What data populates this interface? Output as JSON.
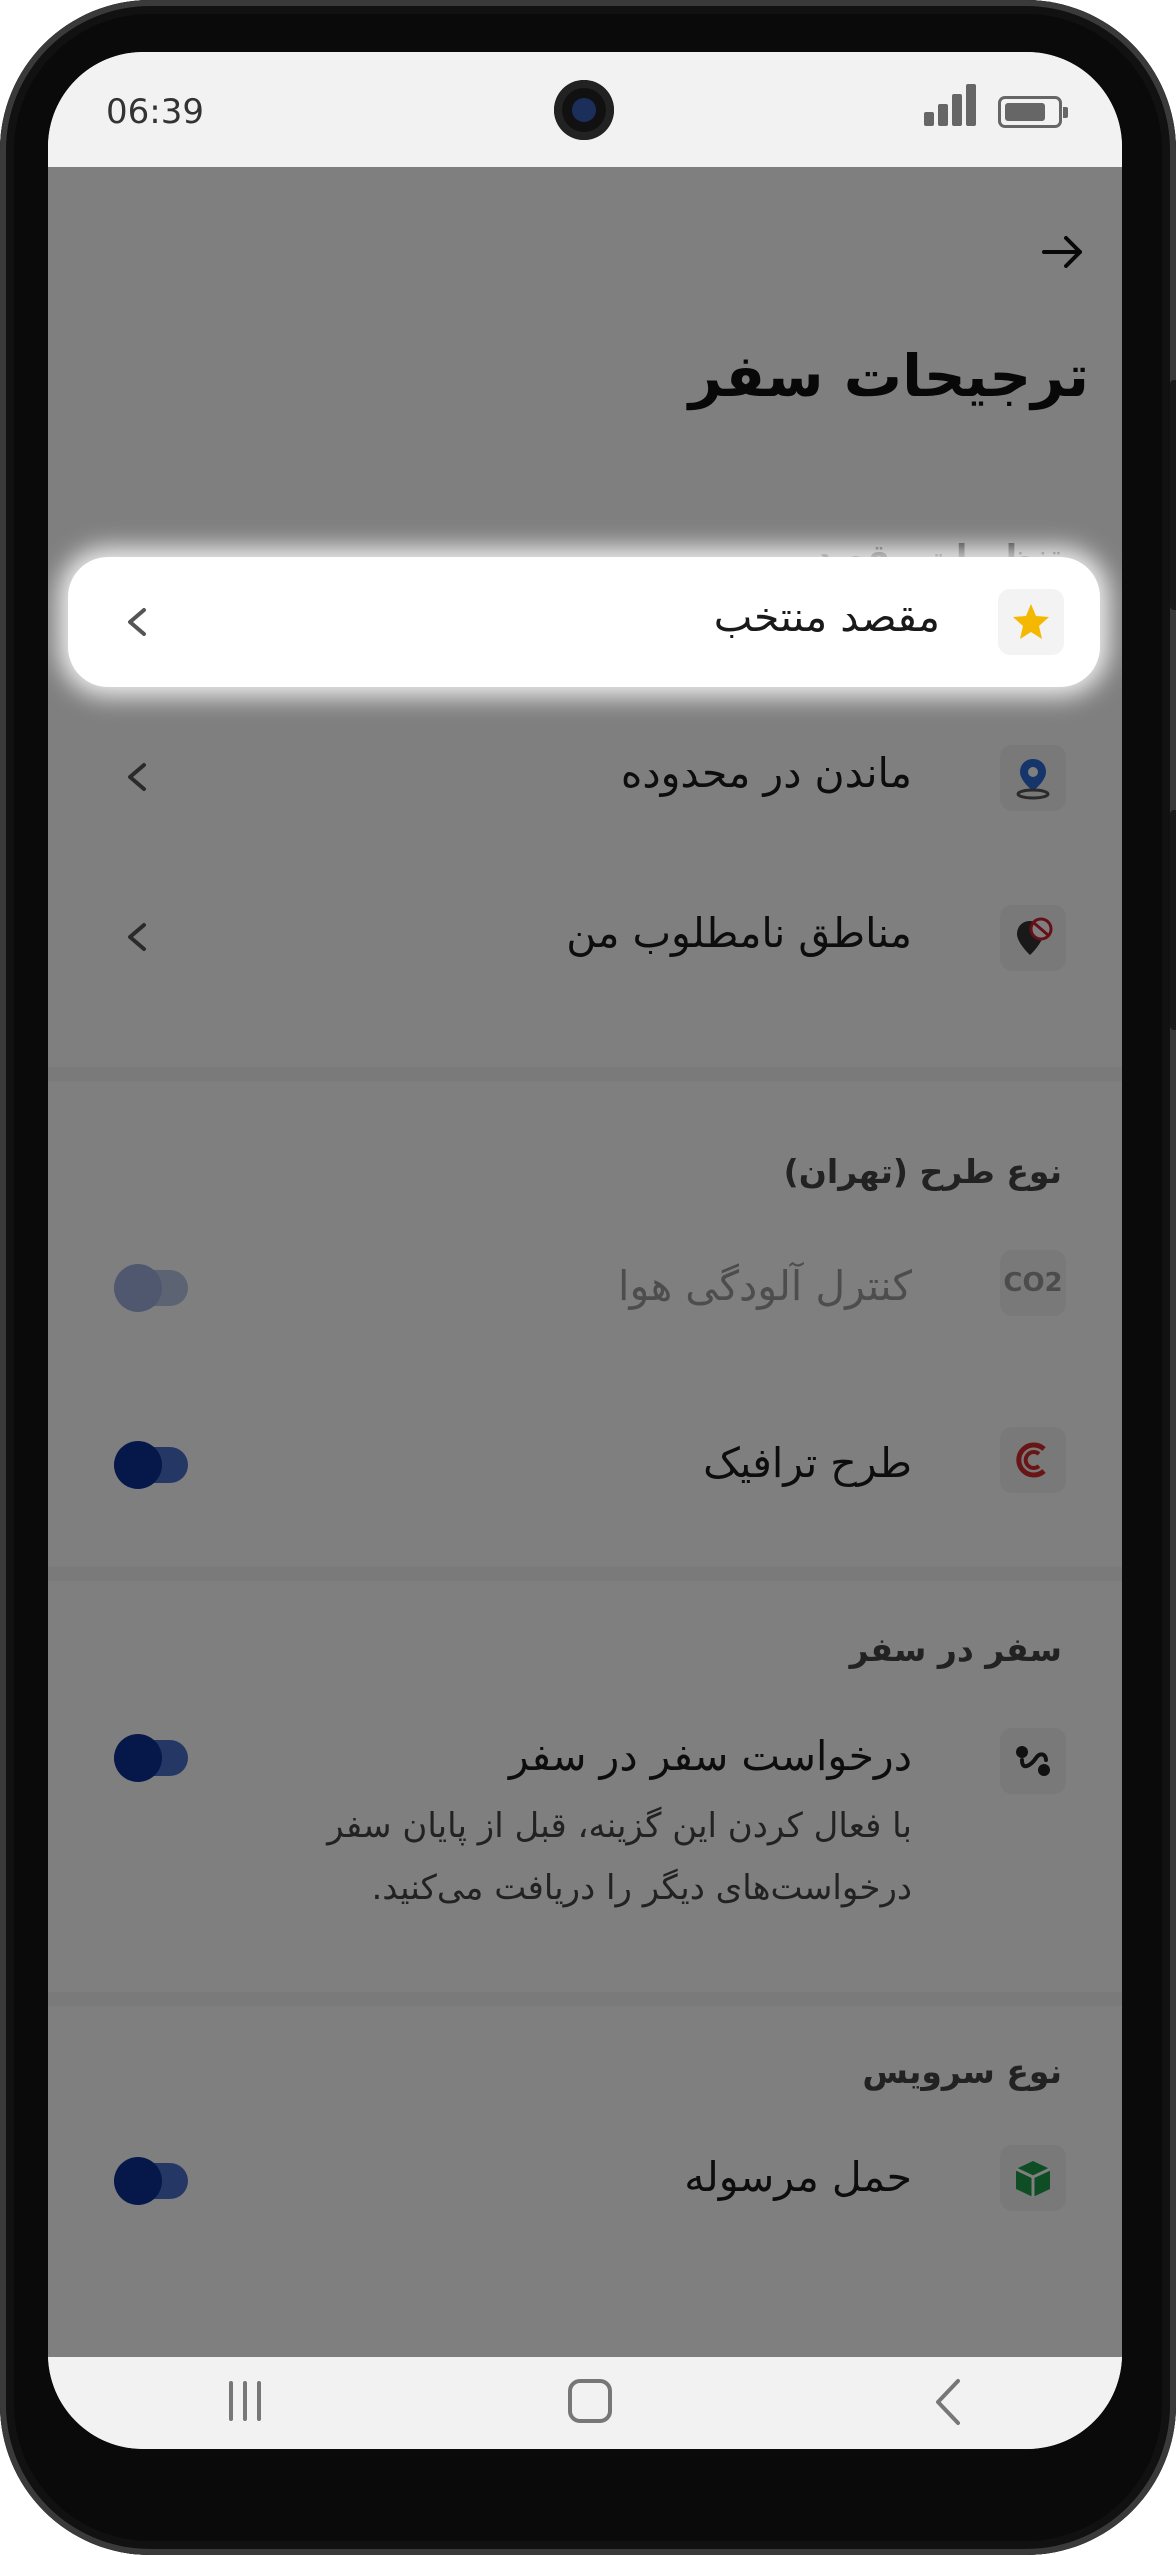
{
  "status": {
    "time": "06:39"
  },
  "header": {
    "title": "ترجیحات سفر"
  },
  "sections": {
    "destination_settings": "تنظیمات مقصد",
    "plan_type": "نوع طرح (تهران)",
    "trip_in_trip": "سفر در سفر",
    "service_type": "نوع سرویس"
  },
  "rows": {
    "favorite_destination": "مقصد منتخب",
    "stay_in_area": "ماندن در محدوده",
    "unwanted_areas": "مناطق نامطلوب من",
    "pollution_control": "کنترل آلودگی هوا",
    "traffic_plan": "طرح ترافیک",
    "trip_request": "درخواست سفر در سفر",
    "trip_request_desc_line1": "با فعال کردن این گزینه، قبل از پایان سفر",
    "trip_request_desc_line2": "درخواست‌های دیگر را دریافت می‌کنید.",
    "parcel_delivery": "حمل مرسوله"
  },
  "toggles": {
    "pollution_control": "off-disabled",
    "traffic_plan": "off",
    "trip_request": "off",
    "parcel_delivery": "off"
  },
  "icons": {
    "co2_text": "CO2"
  },
  "colors": {
    "toggle_knob": "#0d2f93",
    "toggle_track": "#4a6fc8",
    "star": "#f5b800"
  }
}
